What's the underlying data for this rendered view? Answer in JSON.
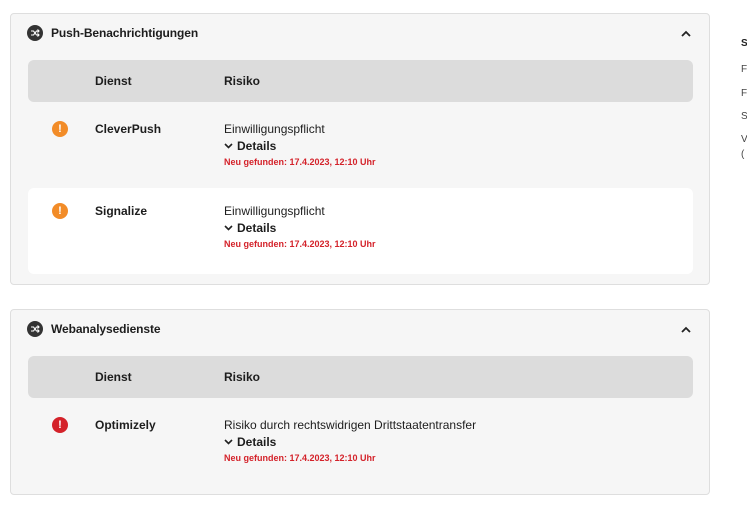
{
  "colors": {
    "panel_bg": "#f6f6f6",
    "table_head_bg": "#dcdcdc",
    "warning_orange": "#f28c28",
    "danger_red": "#d4222a",
    "found_red": "#d4222a"
  },
  "sections": [
    {
      "title": "Push-Benachrichtigungen",
      "icon": "shuffle-icon",
      "expanded": true,
      "columns": {
        "service": "Dienst",
        "risk": "Risiko"
      },
      "rows": [
        {
          "service": "CleverPush",
          "risk": "Einwilligungspflicht",
          "details_label": "Details",
          "found": "Neu gefunden: 17.4.2023, 12:10 Uhr",
          "severity_icon": "warning-icon",
          "severity_color": "#f28c28"
        },
        {
          "service": "Signalize",
          "risk": "Einwilligungspflicht",
          "details_label": "Details",
          "found": "Neu gefunden: 17.4.2023, 12:10 Uhr",
          "severity_icon": "warning-icon",
          "severity_color": "#f28c28"
        }
      ]
    },
    {
      "title": "Webanalysedienste",
      "icon": "shuffle-icon",
      "expanded": true,
      "columns": {
        "service": "Dienst",
        "risk": "Risiko"
      },
      "rows": [
        {
          "service": "Optimizely",
          "risk": "Risiko durch rechtswidrigen Drittstaatentransfer",
          "details_label": "Details",
          "found": "Neu gefunden: 17.4.2023, 12:10 Uhr",
          "severity_icon": "danger-icon",
          "severity_color": "#d4222a"
        }
      ]
    }
  ],
  "right_column_fragments": [
    "S",
    "F",
    "F",
    "S",
    "V",
    "("
  ]
}
